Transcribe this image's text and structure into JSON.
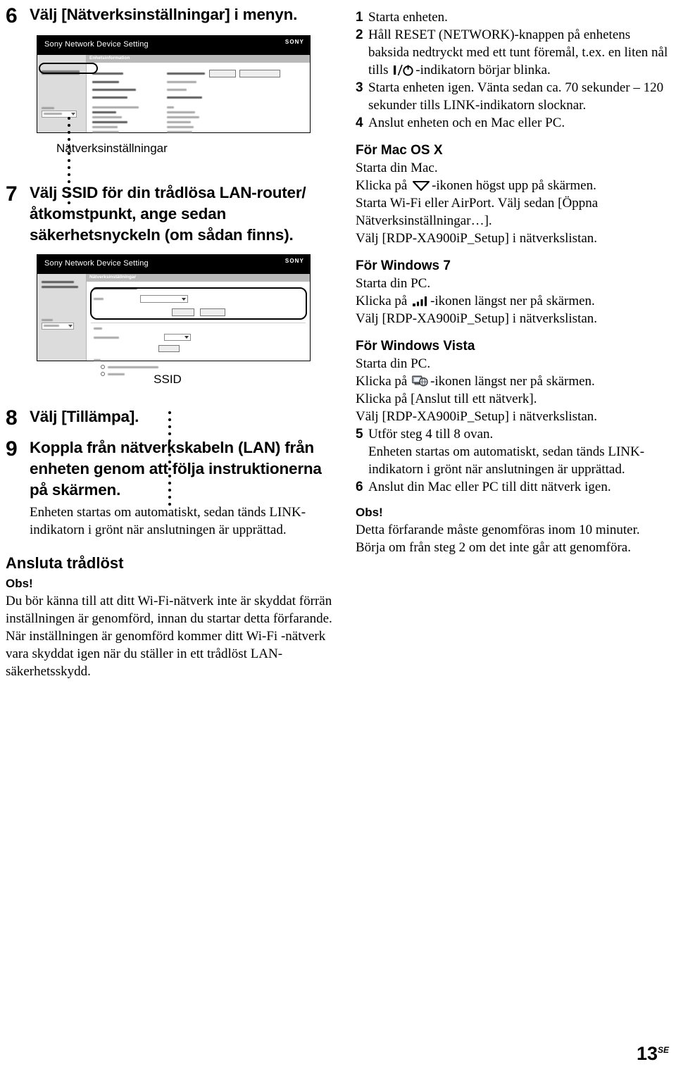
{
  "page": {
    "number": "13",
    "region_code": "SE"
  },
  "left_column": {
    "step6": {
      "number": "6",
      "text": "Välj [Nätverksinställningar] i menyn.",
      "screenshot": {
        "app_title": "Sony Network Device Setting",
        "brand": "SONY",
        "tab_label": "Enhetsinformation",
        "sidebar_item": "Nätverksinställningar",
        "language_label": "Språk",
        "language_value": "Svenska"
      },
      "caption": "Nätverksinställningar"
    },
    "step7": {
      "number": "7",
      "text": "Välj SSID för din trådlösa LAN-router/åtkomstpunkt, ange sedan säkerhetsnyckeln (om sådan finns).",
      "screenshot": {
        "app_title": "Sony Network Device Setting",
        "brand": "SONY",
        "tab_label": "Nätverksinställningar",
        "sidebar_item_1": "Enhetsinformation",
        "sidebar_item_2": "Nätverksinställningar",
        "group_label": "Sökning efter åtkomstpunkt",
        "field_label": "SSID",
        "button_apply": "Tillämpa",
        "button_refresh": "Uppdatera",
        "field2_label": "SSID",
        "field3_label": "Säkerhetsmetod",
        "field3_value": "Inga/öppen",
        "button_apply2": "Tillämpa",
        "radio_group_label": "WPS",
        "radio1": "Konfigurera genom knapptryckning",
        "radio2": "PIN-metod",
        "language_label": "Språk",
        "language_value": "Svenska"
      },
      "caption": "SSID"
    },
    "step8": {
      "number": "8",
      "text": "Välj [Tillämpa]."
    },
    "step9": {
      "number": "9",
      "text": "Koppla från nätverkskabeln (LAN) från enheten genom att följa instruktionerna på skärmen.",
      "body": "Enheten startas om automatiskt, sedan tänds LINK-indikatorn i grönt när anslutningen är upprättad."
    },
    "section": {
      "heading": "Ansluta trådlöst",
      "note_heading": "Obs!",
      "note_body": "Du bör känna till att ditt Wi-Fi-nätverk inte är skyddat förrän inställningen är genomförd, innan du startar detta förfarande. När inställningen är genomförd kommer ditt Wi-Fi -nätverk vara skyddat igen när du ställer in ett trådlöst LAN-säkerhetsskydd."
    }
  },
  "right_column": {
    "steps": [
      {
        "number": "1",
        "text": "Starta enheten."
      },
      {
        "number": "2",
        "text_before_icon": "Håll RESET (NETWORK)-knappen på enhetens baksida nedtryckt med ett tunt föremål, t.ex. en liten nål tills ",
        "icon": "power-standby-icon",
        "text_after_icon": "-indikatorn börjar blinka."
      },
      {
        "number": "3",
        "text": "Starta enheten igen. Vänta sedan ca. 70 sekunder – 120 sekunder tills LINK-indikatorn slocknar."
      },
      {
        "number": "4",
        "text": "Anslut enheten och en Mac eller PC."
      }
    ],
    "mac_section": {
      "heading": "För Mac OS X",
      "line1": "Starta din Mac.",
      "line2_before_icon": "Klicka på ",
      "line2_icon": "airport-wifi-icon",
      "line2_after_icon": "-ikonen högst upp på skärmen.",
      "line3": "Starta Wi-Fi eller AirPort. Välj sedan [Öppna Nätverksinställningar…].",
      "line4": "Välj [RDP-XA900iP_Setup] i nätverkslistan."
    },
    "win7_section": {
      "heading": "För Windows 7",
      "line1": "Starta din PC.",
      "line2_before_icon": "Klicka på ",
      "line2_icon": "signal-bars-icon",
      "line2_after_icon": "-ikonen längst ner på skärmen.",
      "line3": "Välj [RDP-XA900iP_Setup] i nätverkslistan."
    },
    "vista_section": {
      "heading": "För Windows Vista",
      "line1": "Starta din PC.",
      "line2_before_icon": "Klicka på ",
      "line2_icon": "network-globe-icon",
      "line2_after_icon": "-ikonen längst ner på skärmen.",
      "line3": "Klicka på [Anslut till ett nätverk].",
      "line4": "Välj [RDP-XA900iP_Setup] i nätverkslistan."
    },
    "steps_cont": [
      {
        "number": "5",
        "text": "Utför steg 4 till 8 ovan.",
        "body": "Enheten startas om automatiskt, sedan tänds LINK-indikatorn i grönt när anslutningen är upprättad."
      },
      {
        "number": "6",
        "text": "Anslut din Mac eller PC till ditt nätverk igen."
      }
    ],
    "note": {
      "heading": "Obs!",
      "body": "Detta förfarande måste genomföras inom 10 minuter. Börja om från steg 2 om det inte går att genomföra."
    }
  }
}
